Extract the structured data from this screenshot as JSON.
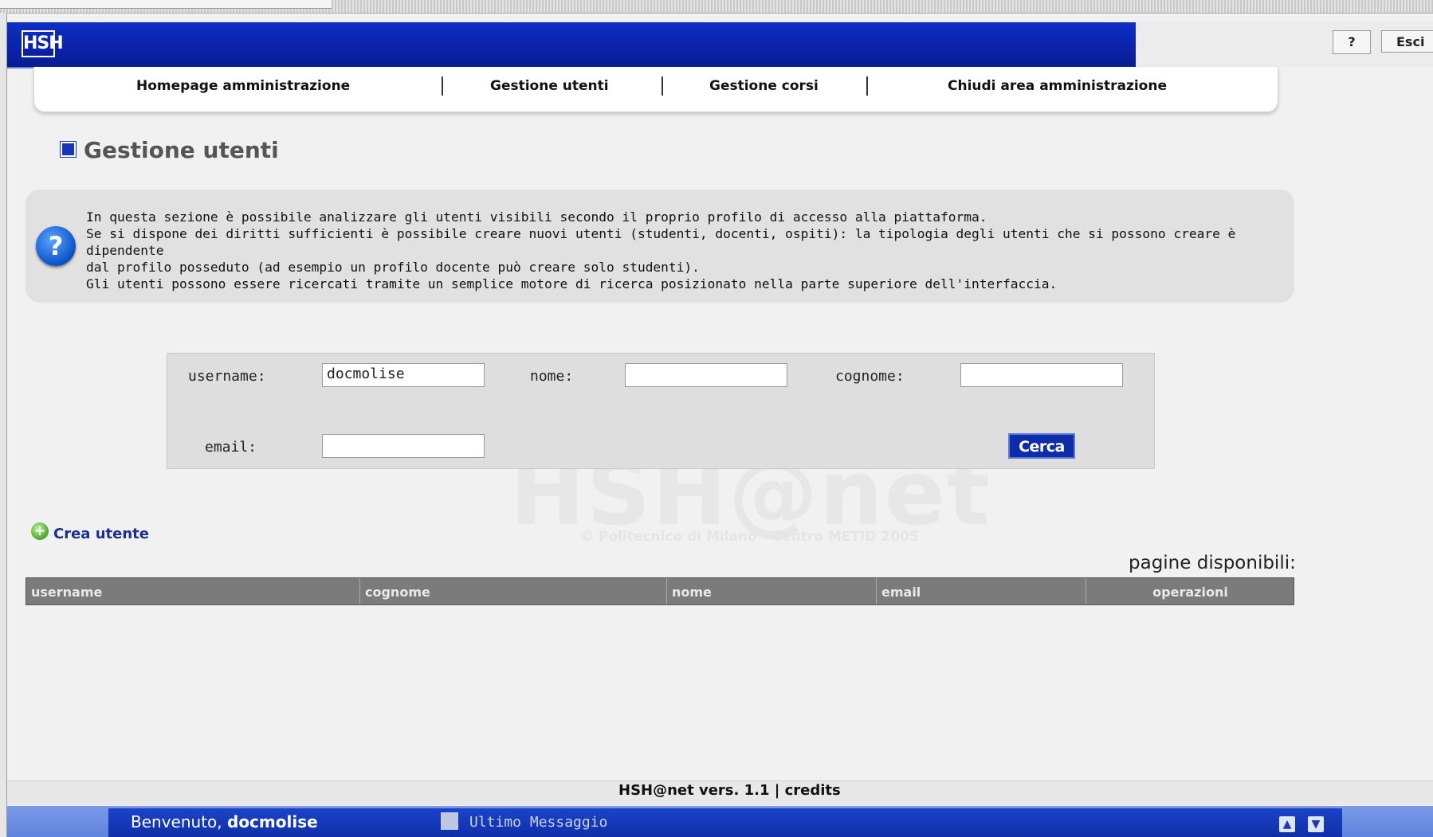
{
  "header": {
    "logo_text": "HSH",
    "help_label": "?",
    "exit_label": "Esci"
  },
  "nav": {
    "items": [
      {
        "label": "Homepage amministrazione"
      },
      {
        "label": "Gestione utenti"
      },
      {
        "label": "Gestione corsi"
      },
      {
        "label": "Chiudi area amministrazione"
      }
    ]
  },
  "page": {
    "title": "Gestione utenti"
  },
  "info": {
    "icon": "question-icon",
    "lines": [
      "In questa sezione è possibile analizzare gli utenti visibili secondo il proprio profilo di accesso alla piattaforma.",
      "Se si dispone dei diritti sufficienti è possibile creare nuovi utenti (studenti, docenti, ospiti): la tipologia degli utenti che si possono creare è dipendente",
      "dal profilo posseduto (ad esempio un profilo docente può creare solo studenti).",
      "Gli utenti possono essere ricercati tramite un semplice motore di ricerca posizionato nella parte superiore dell'interfaccia."
    ]
  },
  "search": {
    "username_label": "username:",
    "username_value": "docmolise",
    "nome_label": "nome:",
    "nome_value": "",
    "cognome_label": "cognome:",
    "cognome_value": "",
    "email_label": "email:",
    "email_value": "",
    "submit_label": "Cerca"
  },
  "watermark": {
    "text": "HSH@net",
    "sub": "© Politecnico di Milano - Centro METID 2005"
  },
  "create_user_label": "Crea utente",
  "pages_label": "pagine disponibili:",
  "table": {
    "columns": [
      "username",
      "cognome",
      "nome",
      "email",
      "operazioni"
    ]
  },
  "footer": {
    "version": "HSH@net vers. 1.1 | credits",
    "welcome_prefix": "Benvenuto,",
    "welcome_user": "docmolise",
    "last_message": "Ultimo Messaggio"
  },
  "colors": {
    "brand_blue": "#0a22a8",
    "table_header": "#7b7b7b"
  }
}
